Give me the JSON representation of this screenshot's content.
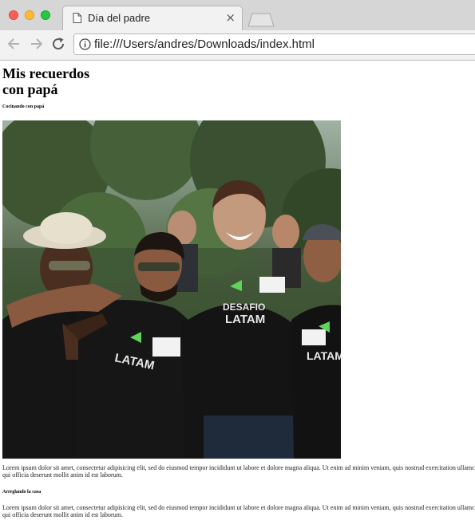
{
  "browser": {
    "tab_title": "Día del padre",
    "tab_close": "×",
    "url": "file:///Users/andres/Downloads/index.html"
  },
  "page": {
    "title": "Mis recuerdos con papá",
    "sections": [
      {
        "heading": "Cocinando con papá",
        "image_alt": "Grupo de personas con camisetas de Desafío Latam",
        "paragraph_lines": [
          "Lorem ipsum dolor sit amet, consectetur adipisicing elit, sed do eiusmod tempor incididunt ut labore et dolore magna aliqua. Ut enim ad minim veniam, quis nostrud exercitation ullamc",
          "qui officia deserunt mollit anim id est laborum."
        ]
      },
      {
        "heading": "Arreglando la casa",
        "paragraph_lines": [
          "Lorem ipsum dolor sit amet, consectetur adipisicing elit, sed do eiusmod tempor incididunt ut labore et dolore magna aliqua. Ut enim ad minim veniam, quis nostrud exercitation ullamc",
          "qui officia deserunt mollit anim id est laborum."
        ]
      }
    ],
    "shirt_logo_line1": "DESAFIO",
    "shirt_logo_line2": "LATAM"
  },
  "icons": {
    "back": "arrow-left-icon",
    "forward": "arrow-right-icon",
    "reload": "reload-icon",
    "info": "info-icon",
    "document": "document-icon"
  },
  "colors": {
    "close": "#fc5f57",
    "minimize": "#fdbc2e",
    "maximize": "#27c840",
    "shirt": "#151515",
    "logo_green": "#5fd35a"
  }
}
